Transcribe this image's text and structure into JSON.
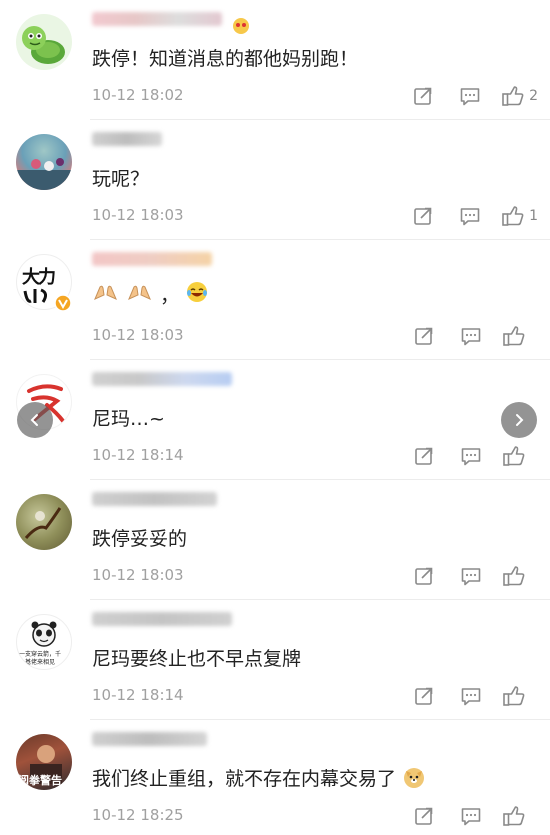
{
  "comments": [
    {
      "text": "跌停！知道消息的都他妈别跑！",
      "time": "10-12 18:02",
      "likes": "2"
    },
    {
      "text": "玩呢？",
      "time": "10-12 18:03",
      "likes": "1"
    },
    {
      "text": "",
      "time": "10-12 18:03",
      "likes": ""
    },
    {
      "text": "尼玛…~",
      "time": "10-12 18:14",
      "likes": ""
    },
    {
      "text": "跌停妥妥的",
      "time": "10-12 18:03",
      "likes": ""
    },
    {
      "text": "尼玛要终止也不早点复牌",
      "time": "10-12 18:14",
      "likes": ""
    },
    {
      "text": "我们终止重组，就不存在内幕交易了",
      "time": "10-12 18:25",
      "likes": ""
    }
  ],
  "avatars": {
    "a3_text": "大力",
    "a6_line1": "一支穿云箭，千",
    "a6_line2": "基佬来相见",
    "a7_text": "阅拳警告"
  },
  "icons": {
    "share": "share-icon",
    "reply": "comment-icon",
    "like": "thumbs-up-icon",
    "left": "chevron-left-icon",
    "right": "chevron-right-icon"
  },
  "colors": {
    "icon": "#8a8a8a",
    "time": "#a0a0a0",
    "text": "#222222",
    "verified": "#f5a623"
  }
}
